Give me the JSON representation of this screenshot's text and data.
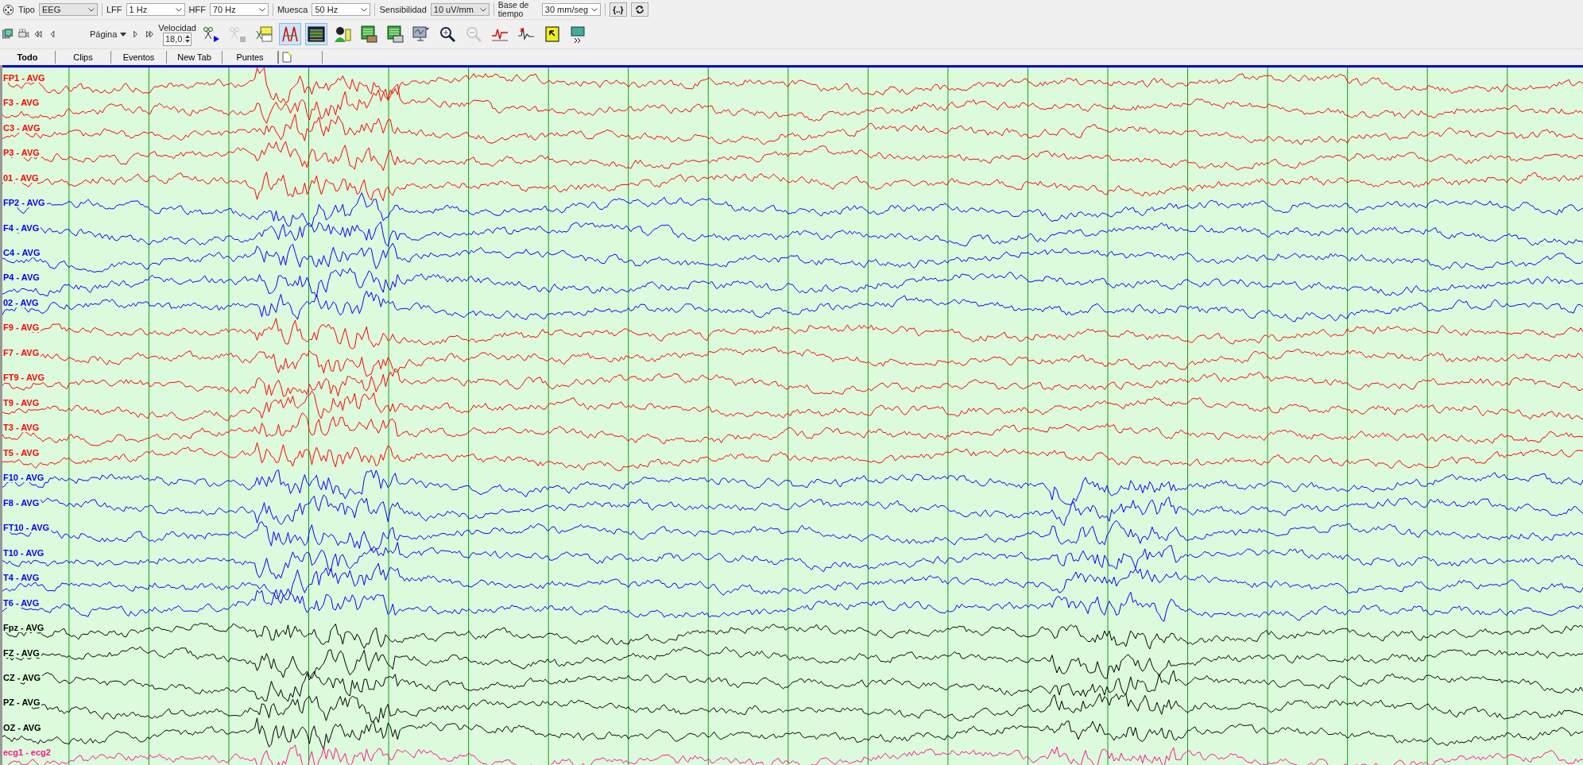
{
  "filters": [
    {
      "label": "Tipo",
      "value": "EEG"
    },
    {
      "label": "LFF",
      "value": "1 Hz"
    },
    {
      "label": "HFF",
      "value": "70 Hz"
    },
    {
      "label": "Muesca",
      "value": "50 Hz"
    },
    {
      "label": "Sensibilidad",
      "value": "10 uV/mm"
    },
    {
      "label": "Base de tiempo",
      "value": "30 mm/seg"
    }
  ],
  "braces_button": "{..}",
  "navigation": {
    "page_select": "Página",
    "speed_label": "Velocidad",
    "speed_value": "18,0"
  },
  "tools": [
    {
      "kind": "clip-start",
      "selected": false,
      "disabled": false
    },
    {
      "kind": "clip-stop",
      "selected": false,
      "disabled": true
    },
    {
      "kind": "clip-edit",
      "selected": false,
      "disabled": false
    },
    {
      "kind": "montage",
      "selected": true,
      "disabled": false
    },
    {
      "kind": "channels",
      "selected": true,
      "disabled": false
    },
    {
      "kind": "patient",
      "selected": false,
      "disabled": false
    },
    {
      "kind": "report",
      "selected": false,
      "disabled": false
    },
    {
      "kind": "print",
      "selected": false,
      "disabled": false
    },
    {
      "kind": "monitor",
      "selected": false,
      "disabled": false
    },
    {
      "kind": "zoom-in",
      "selected": false,
      "disabled": false
    },
    {
      "kind": "zoom-out",
      "selected": false,
      "disabled": true
    },
    {
      "kind": "wave",
      "selected": false,
      "disabled": false
    },
    {
      "kind": "spike",
      "selected": false,
      "disabled": false
    },
    {
      "kind": "note",
      "selected": false,
      "disabled": false
    },
    {
      "kind": "more",
      "selected": false,
      "disabled": false
    }
  ],
  "tabs": [
    {
      "label": "Todo",
      "selected": true
    },
    {
      "label": "Clips",
      "selected": false
    },
    {
      "label": "Eventos",
      "selected": false
    },
    {
      "label": "New Tab",
      "selected": false
    },
    {
      "label": "Puntes",
      "selected": false
    }
  ],
  "channels": [
    {
      "name": "FP1 - AVG",
      "color": "#ff0000"
    },
    {
      "name": "F3 - AVG",
      "color": "#ff0000"
    },
    {
      "name": "C3 - AVG",
      "color": "#ff0000"
    },
    {
      "name": "P3 - AVG",
      "color": "#ff0000"
    },
    {
      "name": "01 - AVG",
      "color": "#ff0000"
    },
    {
      "name": "FP2 - AVG",
      "color": "#0000ff"
    },
    {
      "name": "F4 - AVG",
      "color": "#0000ff"
    },
    {
      "name": "C4 - AVG",
      "color": "#0000ff"
    },
    {
      "name": "P4 - AVG",
      "color": "#0000ff"
    },
    {
      "name": "02 - AVG",
      "color": "#0000ff"
    },
    {
      "name": "F9 - AVG",
      "color": "#ff0000"
    },
    {
      "name": "F7 - AVG",
      "color": "#ff0000"
    },
    {
      "name": "FT9 - AVG",
      "color": "#ff0000"
    },
    {
      "name": "T9 - AVG",
      "color": "#ff0000"
    },
    {
      "name": "T3 - AVG",
      "color": "#ff0000"
    },
    {
      "name": "T5 - AVG",
      "color": "#ff0000"
    },
    {
      "name": "F10 - AVG",
      "color": "#0000ff"
    },
    {
      "name": "F8 - AVG",
      "color": "#0000ff"
    },
    {
      "name": "FT10 - AVG",
      "color": "#0000ff"
    },
    {
      "name": "T10 - AVG",
      "color": "#0000ff"
    },
    {
      "name": "T4 - AVG",
      "color": "#0000ff"
    },
    {
      "name": "T6 - AVG",
      "color": "#0000ff"
    },
    {
      "name": "Fpz - AVG",
      "color": "#000000"
    },
    {
      "name": "FZ - AVG",
      "color": "#000000"
    },
    {
      "name": "CZ - AVG",
      "color": "#000000"
    },
    {
      "name": "PZ - AVG",
      "color": "#000000"
    },
    {
      "name": "OZ - AVG",
      "color": "#000000"
    },
    {
      "name": "ecg1 - ecg2",
      "color": "#ff1493"
    }
  ]
}
